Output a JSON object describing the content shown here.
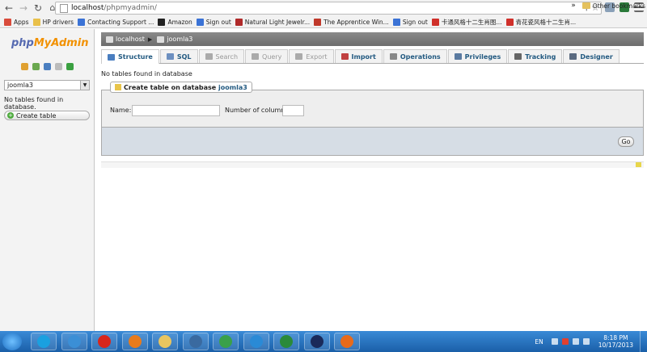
{
  "browser": {
    "url_host": "localhost",
    "url_path": "/phpmyadmin/",
    "bookmarks": [
      {
        "label": "Apps",
        "color": "#d94b3b"
      },
      {
        "label": "HP drivers",
        "color": "#e9c04a"
      },
      {
        "label": "Contacting Support ...",
        "color": "#3b73d6"
      },
      {
        "label": "Amazon",
        "color": "#222222"
      },
      {
        "label": "Sign out",
        "color": "#3b73d6"
      },
      {
        "label": "Natural Light Jewelr...",
        "color": "#b02a2a"
      },
      {
        "label": "The Apprentice Win...",
        "color": "#c0392b"
      },
      {
        "label": "Sign out",
        "color": "#3b73d6"
      },
      {
        "label": "卡通风格十二生肖图...",
        "color": "#d0302a"
      },
      {
        "label": "青花瓷风格十二生肖...",
        "color": "#d0302a"
      }
    ],
    "overflow_chevron": "»",
    "other_bookmarks": "Other bookmarks"
  },
  "sidebar": {
    "logo": {
      "part1": "php",
      "part2": "MyAdmin"
    },
    "nav_icons": [
      {
        "name": "home-icon",
        "color": "#e0a030"
      },
      {
        "name": "exit-icon",
        "color": "#6aa84f"
      },
      {
        "name": "query-icon",
        "color": "#4a7ec0"
      },
      {
        "name": "docs-icon",
        "color": "#bbbbbb"
      },
      {
        "name": "reload-icon",
        "color": "#3aa040"
      }
    ],
    "db_selected": "joomla3",
    "no_tables": "No tables found in database.",
    "create_table": "Create table"
  },
  "breadcrumb": {
    "server": "localhost",
    "database": "joomla3"
  },
  "tabs": [
    {
      "label": "Structure",
      "state": "active",
      "color": "#4a7ec0"
    },
    {
      "label": "SQL",
      "state": "normal",
      "color": "#6c8fc0"
    },
    {
      "label": "Search",
      "state": "disabled",
      "color": "#aaaaaa"
    },
    {
      "label": "Query",
      "state": "disabled",
      "color": "#aaaaaa"
    },
    {
      "label": "Export",
      "state": "disabled",
      "color": "#aaaaaa"
    },
    {
      "label": "Import",
      "state": "normal",
      "color": "#c04040"
    },
    {
      "label": "Operations",
      "state": "normal",
      "color": "#888888"
    },
    {
      "label": "Privileges",
      "state": "normal",
      "color": "#5a7aa0"
    },
    {
      "label": "Tracking",
      "state": "normal",
      "color": "#666666"
    },
    {
      "label": "Designer",
      "state": "normal",
      "color": "#5a6a80"
    }
  ],
  "main": {
    "no_tables": "No tables found in database",
    "create_legend": "Create table on database",
    "create_legend_db": "joomla3",
    "name_label": "Name:",
    "name_value": "",
    "columns_label": "Number of columns:",
    "columns_value": "",
    "go_button": "Go"
  },
  "taskbar": {
    "apps": [
      {
        "name": "app-icon-1",
        "color": "#1aa0e0"
      },
      {
        "name": "safari-icon",
        "color": "#3b8fd6"
      },
      {
        "name": "opera-icon",
        "color": "#d8261c"
      },
      {
        "name": "firefox-icon",
        "color": "#e87b1c"
      },
      {
        "name": "explorer-folder-icon",
        "color": "#e8c560"
      },
      {
        "name": "network-icon",
        "color": "#3a6aa0"
      },
      {
        "name": "chrome-icon",
        "color": "#3aa04a"
      },
      {
        "name": "ie-icon",
        "color": "#2a8ad6"
      },
      {
        "name": "excel-icon",
        "color": "#2a8a3a"
      },
      {
        "name": "photoshop-icon",
        "color": "#1a2a5a"
      },
      {
        "name": "xampp-icon",
        "color": "#e86a1a"
      }
    ],
    "language": "EN",
    "time": "8:18 PM",
    "date": "10/17/2013"
  }
}
